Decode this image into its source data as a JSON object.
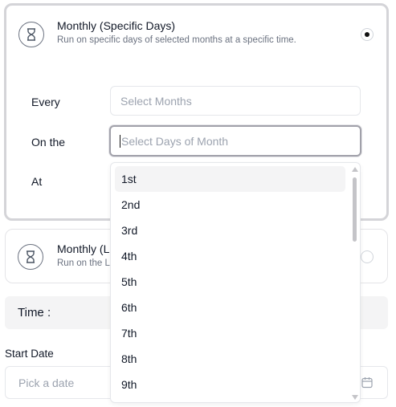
{
  "options": [
    {
      "title": "Monthly (Specific Days)",
      "description": "Run on specific days of selected months at a specific time.",
      "selected": true
    },
    {
      "title": "Monthly (L",
      "description": "Run on the L",
      "selected": false
    }
  ],
  "form": {
    "every_label": "Every",
    "months_placeholder": "Select Months",
    "on_the_label": "On the",
    "days_placeholder": "Select Days of Month",
    "at_label": "At"
  },
  "time_label": "Time :",
  "start_date": {
    "label": "Start Date",
    "placeholder": "Pick a date"
  },
  "dropdown": {
    "items": [
      "1st",
      "2nd",
      "3rd",
      "4th",
      "5th",
      "6th",
      "7th",
      "8th",
      "9th"
    ],
    "highlighted": "1st"
  },
  "colors": {
    "border_selected": "#d4d4d8",
    "highlight": "#f4f4f5",
    "muted_text": "#6b7280",
    "placeholder": "#9ca3af"
  },
  "icons": {
    "option_icon": "hourglass-icon",
    "date_icon": "calendar-icon"
  }
}
